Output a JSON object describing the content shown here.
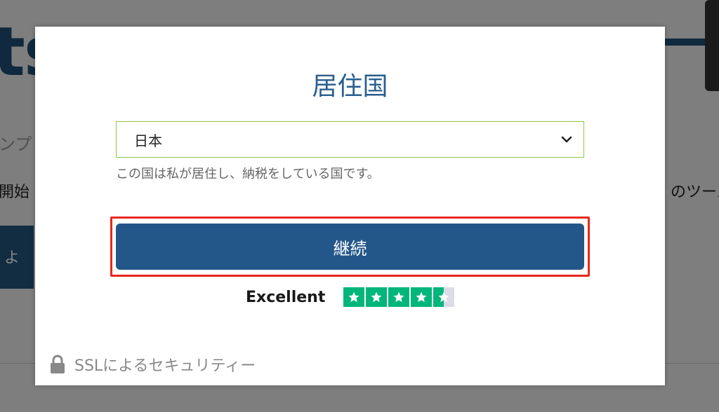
{
  "background": {
    "logo_text": "ts",
    "subtitle_fragment": "ンプ",
    "start_fragment": "開始",
    "tools_fragment": "のツール",
    "button_fragment": "よ"
  },
  "modal": {
    "title": "居住国",
    "country_select": {
      "selected": "日本",
      "options": [
        "日本"
      ]
    },
    "help_text": "この国は私が居住し、納税をしている国です。",
    "continue_label": "継続",
    "rating": {
      "label": "Excellent",
      "stars": 4.5,
      "max_stars": 5
    },
    "security_text": "SSLによるセキュリティー"
  },
  "colors": {
    "accent": "#23578a",
    "title": "#2a5f8f",
    "highlight": "#e8281a",
    "select_border": "#8cc63f",
    "star_green": "#00b67a"
  }
}
